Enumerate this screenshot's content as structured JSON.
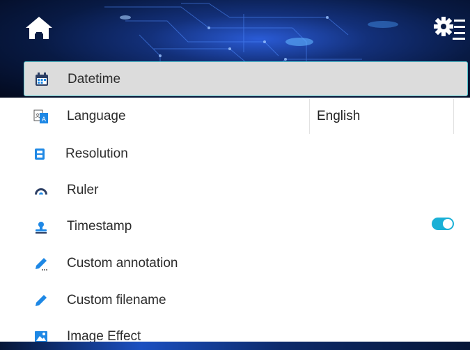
{
  "header": {
    "home_icon": "home-icon",
    "settings_icon": "settings-gear-icon"
  },
  "menu": {
    "items": [
      {
        "label": "Datetime",
        "icon": "calendar-icon",
        "selected": true
      },
      {
        "label": "Language",
        "icon": "translate-icon",
        "value": "English"
      },
      {
        "label": "Resolution",
        "icon": "film-icon"
      },
      {
        "label": "Ruler",
        "icon": "protractor-icon"
      },
      {
        "label": "Timestamp",
        "icon": "stamp-icon",
        "toggle": true
      },
      {
        "label": "Custom annotation",
        "icon": "pen-annotation-icon"
      },
      {
        "label": "Custom filename",
        "icon": "pen-icon"
      },
      {
        "label": "Image Effect",
        "icon": "image-icon"
      }
    ]
  },
  "colors": {
    "accent": "#1ab0d6",
    "icon_blue": "#1e88e5",
    "selected_bg": "#dcdcdc",
    "selected_border": "#5ac8d0"
  }
}
